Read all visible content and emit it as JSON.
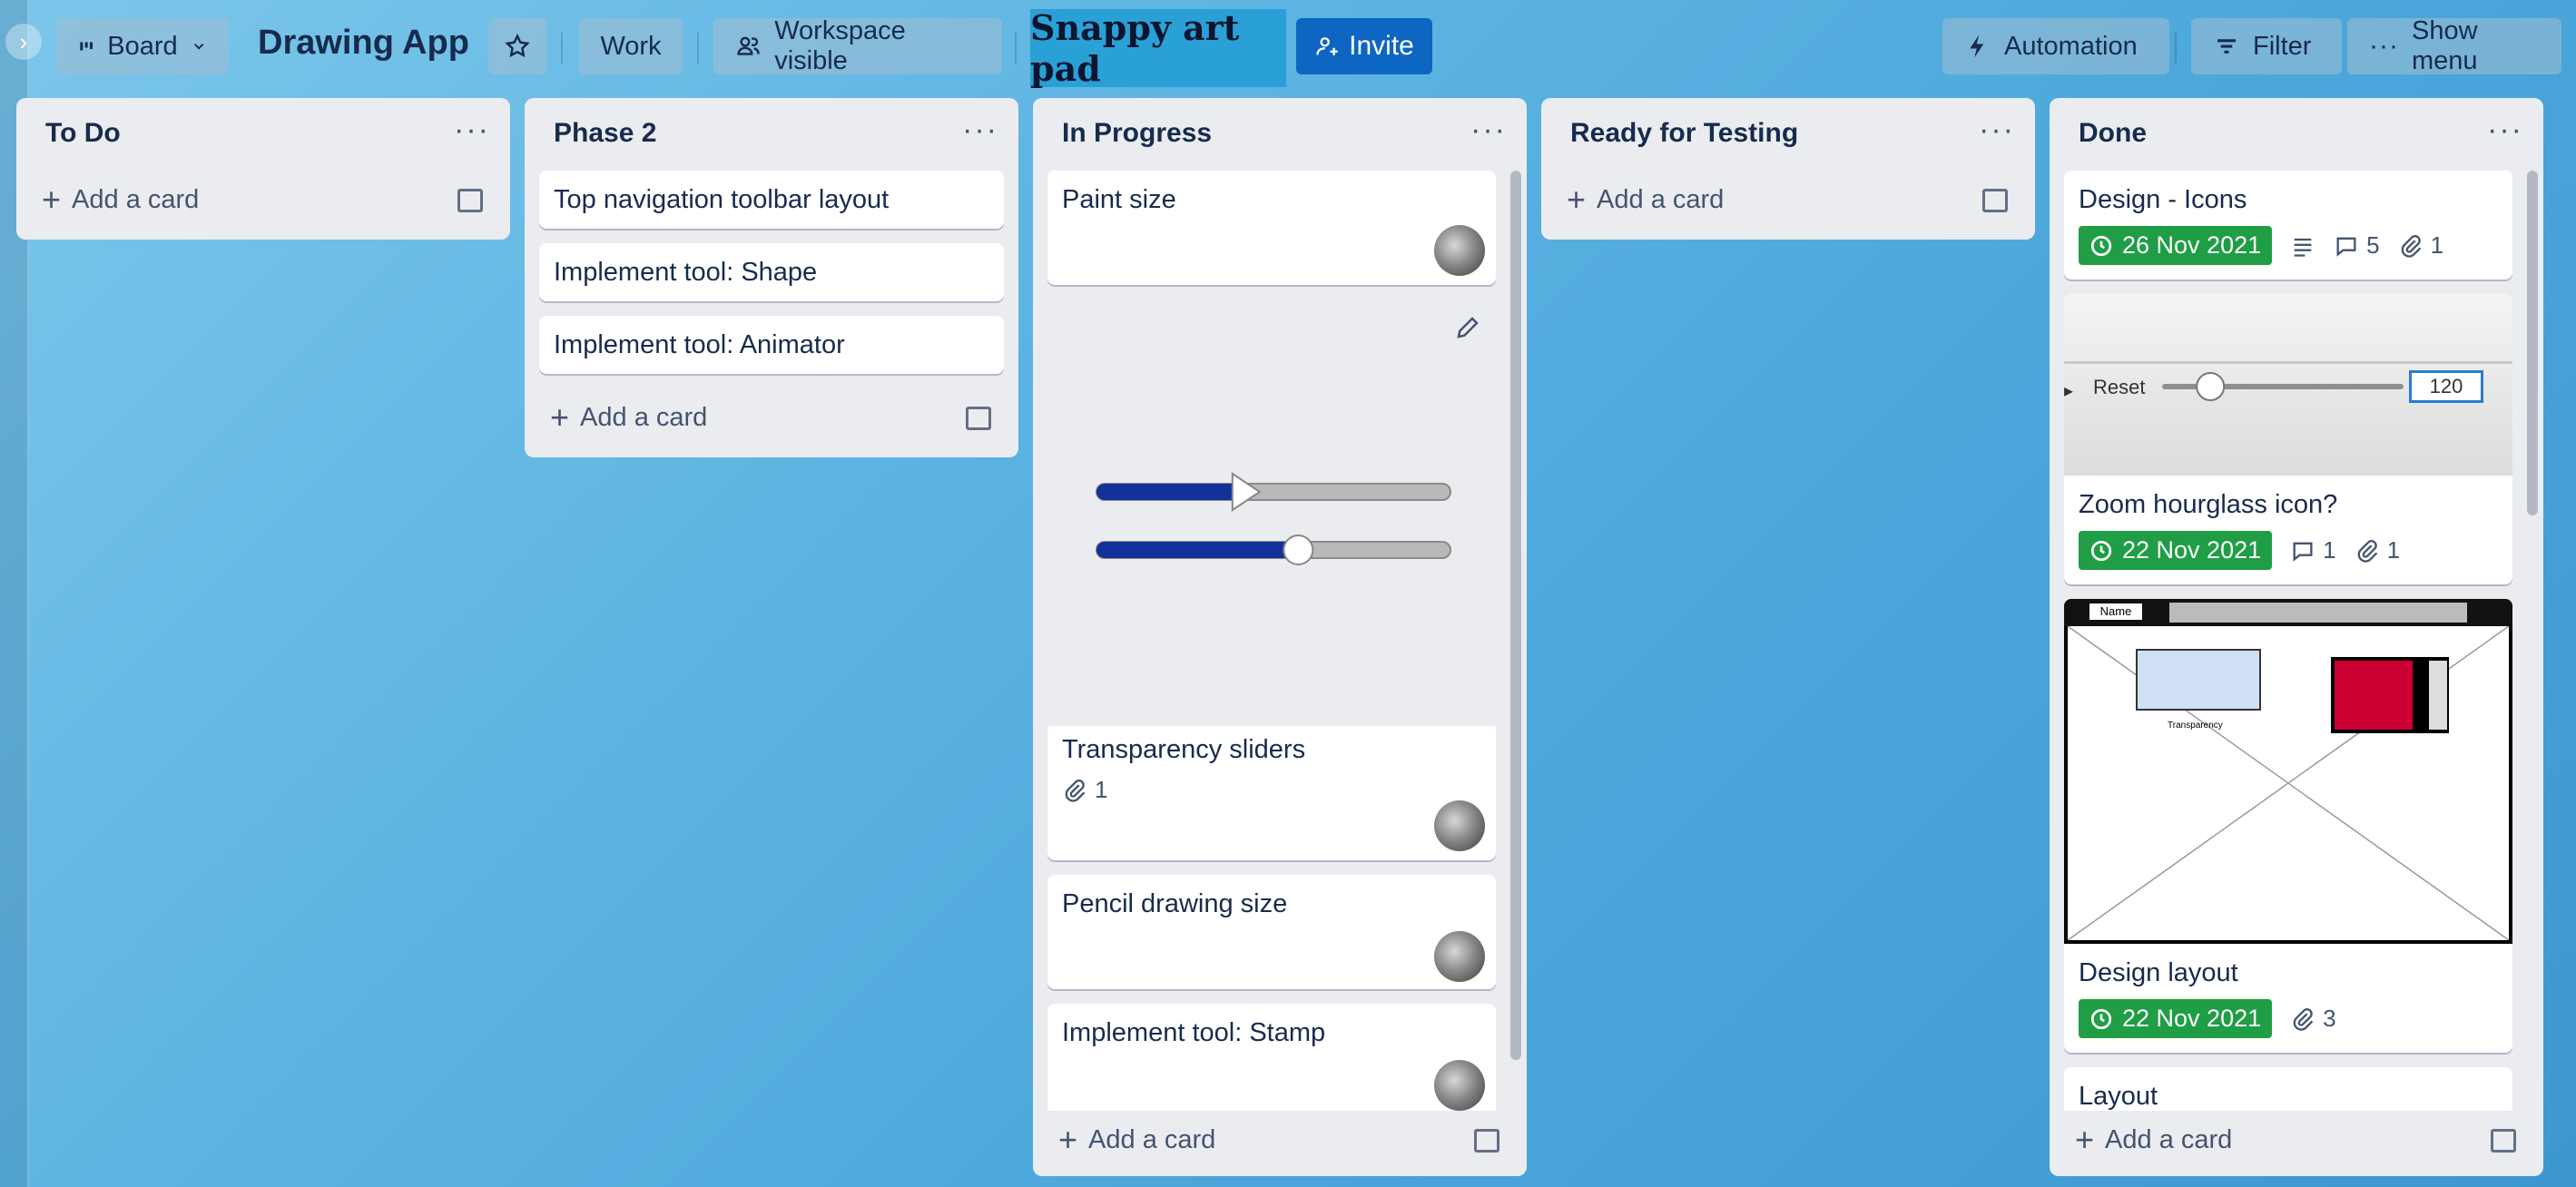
{
  "header": {
    "view_label": "Board",
    "title": "Drawing App",
    "workspace_label": "Work",
    "visibility_label": "Workspace visible",
    "snappy_label": "Snappy art pad",
    "invite_label": "Invite",
    "automation_label": "Automation",
    "filter_label": "Filter",
    "menu_label": "Show menu"
  },
  "lists": [
    {
      "title": "To Do",
      "add_label": "Add a card"
    },
    {
      "title": "Phase 2",
      "add_label": "Add a card",
      "cards": [
        "Top navigation toolbar layout",
        "Implement tool: Shape",
        "Implement tool: Animator"
      ]
    },
    {
      "title": "In Progress",
      "add_label": "Add a card",
      "cards": [
        {
          "title": "Paint size"
        },
        {
          "title": "Transparency sliders",
          "attachments": "1",
          "slider1": 0.42,
          "slider2": 0.57
        },
        {
          "title": "Pencil drawing size"
        },
        {
          "title": "Implement tool: Stamp"
        }
      ]
    },
    {
      "title": "Ready for Testing",
      "add_label": "Add a card"
    },
    {
      "title": "Done",
      "add_label": "Add a card",
      "cards": [
        {
          "title": "Design - Icons",
          "due": "26 Nov 2021",
          "comments": "5",
          "attachments": "1"
        },
        {
          "title": "Zoom hourglass icon?",
          "due": "22 Nov 2021",
          "comments": "1",
          "attachments": "1",
          "cover": {
            "reset_label": "Reset",
            "value": "120",
            "slider": 0.2
          }
        },
        {
          "title": "Design layout",
          "due": "22 Nov 2021",
          "attachments": "3",
          "cover": {
            "name_label": "Name",
            "panel_label": "Transparency"
          }
        },
        {
          "title": "Layout"
        }
      ]
    }
  ]
}
